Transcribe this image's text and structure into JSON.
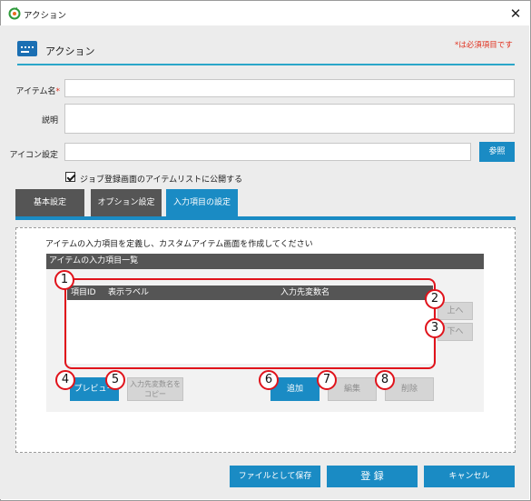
{
  "window": {
    "title": "アクション",
    "close_glyph": "✕"
  },
  "header": {
    "title": "アクション",
    "required_note": "*は必須項目です",
    "icon": "action-icon"
  },
  "form": {
    "item_name_label": "アイテム名",
    "required_mark": "*",
    "item_name_value": "",
    "description_label": "説明",
    "description_value": "",
    "icon_setting_label": "アイコン設定",
    "icon_setting_value": "",
    "browse_button": "参照",
    "publish_checkbox_label": "ジョブ登録画面のアイテムリストに公開する",
    "publish_checked": true
  },
  "tabs": [
    {
      "label": "基本設定",
      "active": false
    },
    {
      "label": "オプション設定",
      "active": false
    },
    {
      "label": "入力項目の設定",
      "active": true
    }
  ],
  "input_items": {
    "description": "アイテムの入力項目を定義し、カスタムアイテム画面を作成してください",
    "list_title": "アイテムの入力項目一覧",
    "columns": [
      "項目ID",
      "表示ラベル",
      "入力先変数名"
    ],
    "rows": [],
    "up_button": "上へ",
    "down_button": "下へ",
    "preview_button": "プレビュー",
    "copy_var_button": "入力先変数名をコピー",
    "add_button": "追加",
    "edit_button": "編集",
    "delete_button": "削除"
  },
  "callouts": [
    "1",
    "2",
    "3",
    "4",
    "5",
    "6",
    "7",
    "8"
  ],
  "footer": {
    "save_file_button": "ファイルとして保存",
    "register_button": "登 録",
    "cancel_button": "キャンセル"
  },
  "colors": {
    "accent": "#1a8bc4",
    "tab_dark": "#555555",
    "callout_red": "#e0131b",
    "required_red": "#e0301e"
  }
}
